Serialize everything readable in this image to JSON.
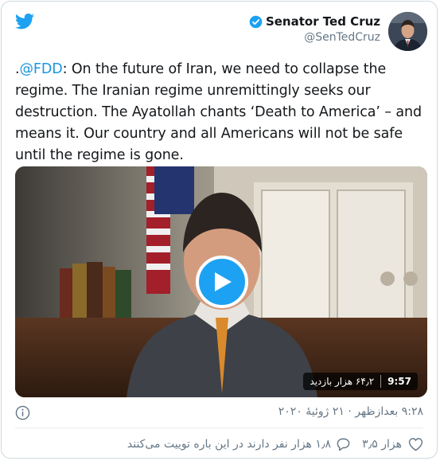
{
  "tweet": {
    "author_name": "Senator Ted Cruz",
    "author_handle": "@SenTedCruz",
    "text_prefix": ".",
    "mention": "@FDD",
    "text_body": ": On the future of Iran, we need to collapse the regime. The Iranian regime unremittingly seeks our destruction. The Ayatollah chants ‘Death to America’ – and means it. Our country and all Americans will not be safe until the regime is gone.",
    "video": {
      "duration": "9:57",
      "views": "۶۴٫۲ هزار بازدید"
    },
    "timestamp": "۹:۲۸ بعدازظهر · ۲۱ ژوئیهٔ ۲۰۲۰",
    "likes": "۳٫۵ هزار",
    "reply_prompt": "۱٫۸ هزار نفر دارند در این باره توییت می‌کنند"
  },
  "colors": {
    "brand": "#1da1f2",
    "text": "#14171a",
    "secondary": "#657786",
    "border": "#cfd9de"
  },
  "icons": [
    "twitter-logo-icon",
    "verified-badge-icon",
    "play-icon",
    "info-icon",
    "heart-icon",
    "reply-bubble-icon"
  ]
}
